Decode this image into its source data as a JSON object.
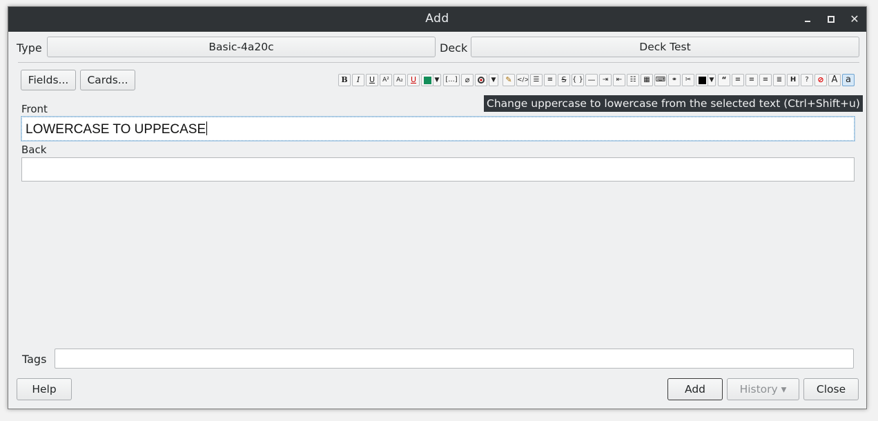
{
  "window": {
    "title": "Add"
  },
  "note_type": {
    "label": "Type",
    "value": "Basic-4a20c"
  },
  "deck": {
    "label": "Deck",
    "value": "Deck Test"
  },
  "buttons": {
    "fields": "Fields...",
    "cards": "Cards..."
  },
  "toolbar": {
    "bold": "B",
    "italic": "I",
    "underline": "U",
    "superscript": "A²",
    "subscript": "A₂",
    "clear_format": "U",
    "cloze": "[...]",
    "html": "</>",
    "block": "{ }",
    "heading": "H",
    "quote": "“",
    "help": "?",
    "upper": "A",
    "lower": "a",
    "text_color": "#138e5a",
    "highlight_color": "#000000"
  },
  "tooltip": {
    "text": "Change uppercase to lowercase from the selected text  (Ctrl+Shift+u)"
  },
  "fields": [
    {
      "label": "Front",
      "value": "LOWERCASE TO UPPECASE"
    },
    {
      "label": "Back",
      "value": ""
    }
  ],
  "tags": {
    "label": "Tags",
    "value": ""
  },
  "bottom": {
    "help": "Help",
    "add": "Add",
    "history": "History ▾",
    "close": "Close"
  }
}
